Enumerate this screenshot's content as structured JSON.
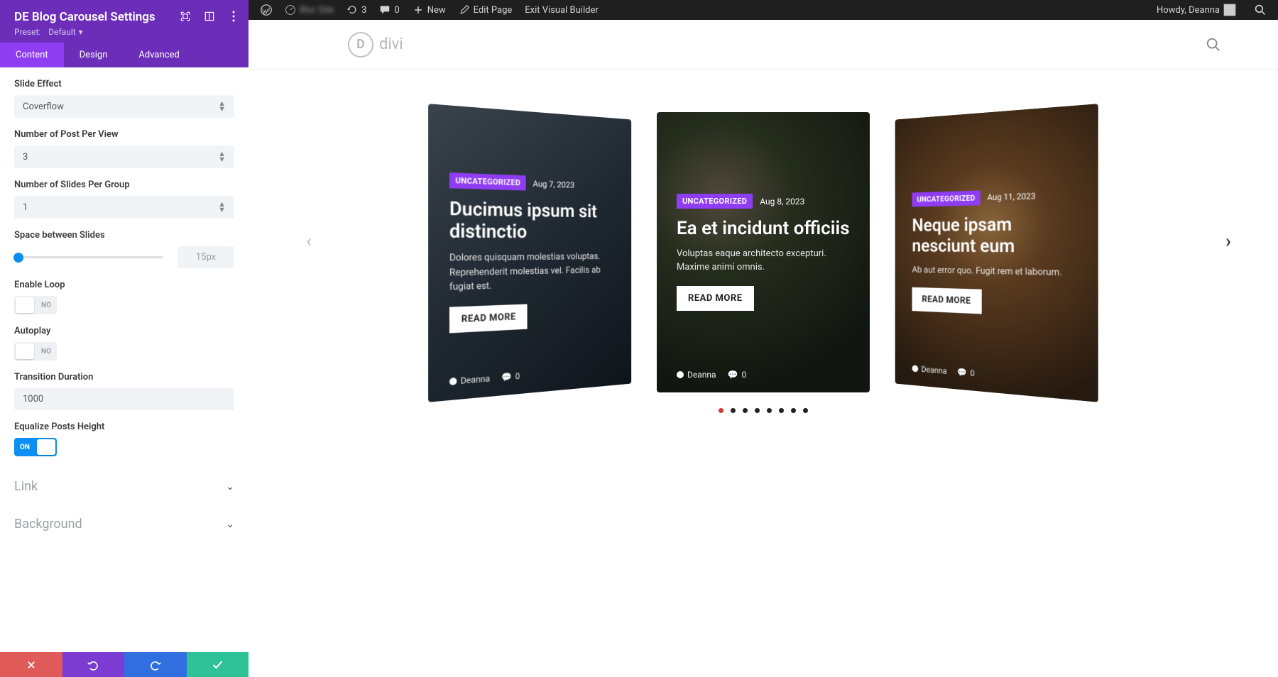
{
  "wpbar": {
    "blurred_name": "Blur Site",
    "revisions": "3",
    "comments": "0",
    "new": "New",
    "edit": "Edit Page",
    "exit": "Exit Visual Builder",
    "howdy": "Howdy, Deanna"
  },
  "sidebar": {
    "title": "DE Blog Carousel Settings",
    "preset_label": "Preset:",
    "preset_value": "Default",
    "tabs": [
      "Content",
      "Design",
      "Advanced"
    ],
    "fields": {
      "slide_effect": {
        "label": "Slide Effect",
        "value": "Coverflow"
      },
      "posts_per_view": {
        "label": "Number of Post Per View",
        "value": "3"
      },
      "slides_per_group": {
        "label": "Number of Slides Per Group",
        "value": "1"
      },
      "space_between": {
        "label": "Space between Slides",
        "value": "15px"
      },
      "enable_loop": {
        "label": "Enable Loop",
        "value": "NO"
      },
      "autoplay": {
        "label": "Autoplay",
        "value": "NO"
      },
      "transition": {
        "label": "Transition Duration",
        "value": "1000"
      },
      "equalize": {
        "label": "Equalize Posts Height",
        "value": "ON"
      }
    },
    "accordions": [
      "Link",
      "Background"
    ]
  },
  "site": {
    "logo_text": "divi",
    "logo_letter": "D"
  },
  "cards": [
    {
      "category": "UNCATEGORIZED",
      "date": "Aug 7, 2023",
      "title": "Ducimus ipsum sit distinctio",
      "excerpt": "Dolores quisquam molestias voluptas. Reprehenderit molestias vel. Facilis ab fugiat est.",
      "read_more": "READ MORE",
      "author": "Deanna",
      "comments": "0"
    },
    {
      "category": "UNCATEGORIZED",
      "date": "Aug 8, 2023",
      "title": "Ea et incidunt officiis",
      "excerpt": "Voluptas eaque architecto excepturi. Maxime animi omnis.",
      "read_more": "READ MORE",
      "author": "Deanna",
      "comments": "0"
    },
    {
      "category": "UNCATEGORIZED",
      "date": "Aug 11, 2023",
      "title": "Neque ipsam nesciunt eum",
      "excerpt": "Ab aut error quo. Fugit rem et laborum.",
      "read_more": "READ MORE",
      "author": "Deanna",
      "comments": "0"
    }
  ],
  "dot_count": 8
}
